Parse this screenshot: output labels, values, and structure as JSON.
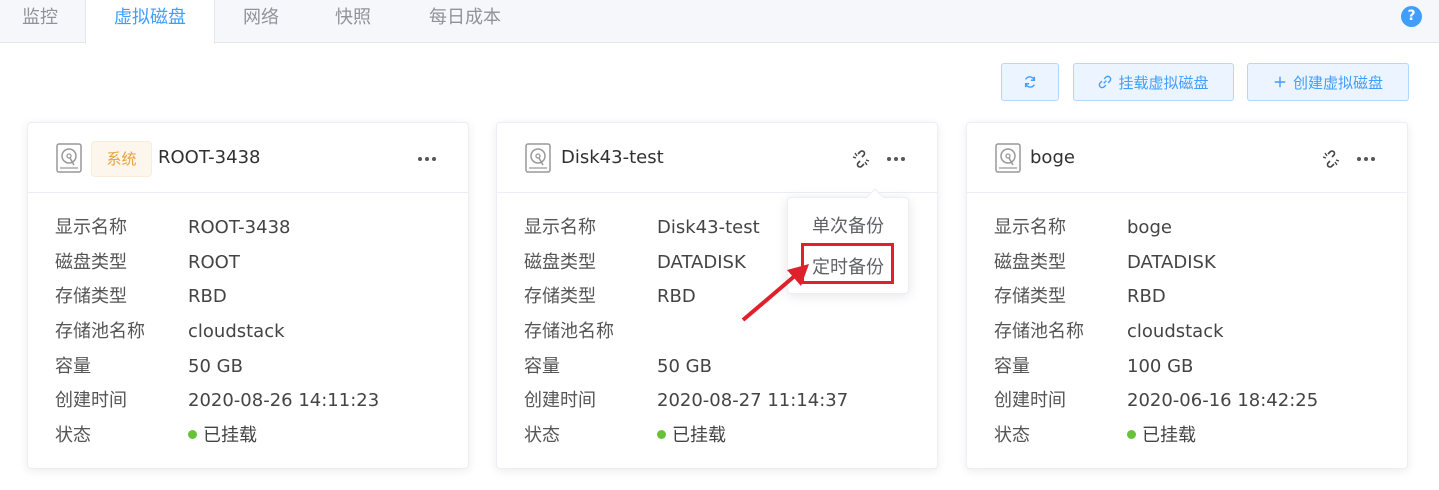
{
  "tabs": [
    {
      "label": "监控",
      "active": false
    },
    {
      "label": "虚拟磁盘",
      "active": true
    },
    {
      "label": "网络",
      "active": false
    },
    {
      "label": "快照",
      "active": false
    },
    {
      "label": "每日成本",
      "active": false
    }
  ],
  "help_icon_text": "?",
  "toolbar": {
    "refresh": "refresh-icon",
    "attach_label": "挂载虚拟磁盘",
    "create_label": "创建虚拟磁盘"
  },
  "field_labels": {
    "name": "显示名称",
    "disk_type": "磁盘类型",
    "storage_type": "存储类型",
    "pool": "存储池名称",
    "capacity": "容量",
    "created": "创建时间",
    "status": "状态"
  },
  "disks": [
    {
      "tag": "系统",
      "title": "ROOT-3438",
      "name": "ROOT-3438",
      "disk_type": "ROOT",
      "storage_type": "RBD",
      "pool": "cloudstack",
      "capacity": "50 GB",
      "created": "2020-08-26 14:11:23",
      "status": "已挂载"
    },
    {
      "title": "Disk43-test",
      "name": "Disk43-test",
      "disk_type": "DATADISK",
      "storage_type": "RBD",
      "pool": "",
      "capacity": "50 GB",
      "created": "2020-08-27 11:14:37",
      "status": "已挂载"
    },
    {
      "title": "boge",
      "name": "boge",
      "disk_type": "DATADISK",
      "storage_type": "RBD",
      "pool": "cloudstack",
      "capacity": "100 GB",
      "created": "2020-06-16 18:42:25",
      "status": "已挂载"
    }
  ],
  "dropdown": {
    "items": [
      "单次备份",
      "定时备份"
    ],
    "highlighted": "定时备份"
  },
  "colors": {
    "accent": "#409eff",
    "status_ok": "#67c23a",
    "annotation": "#e0202a",
    "tag": "#e6a23c"
  }
}
